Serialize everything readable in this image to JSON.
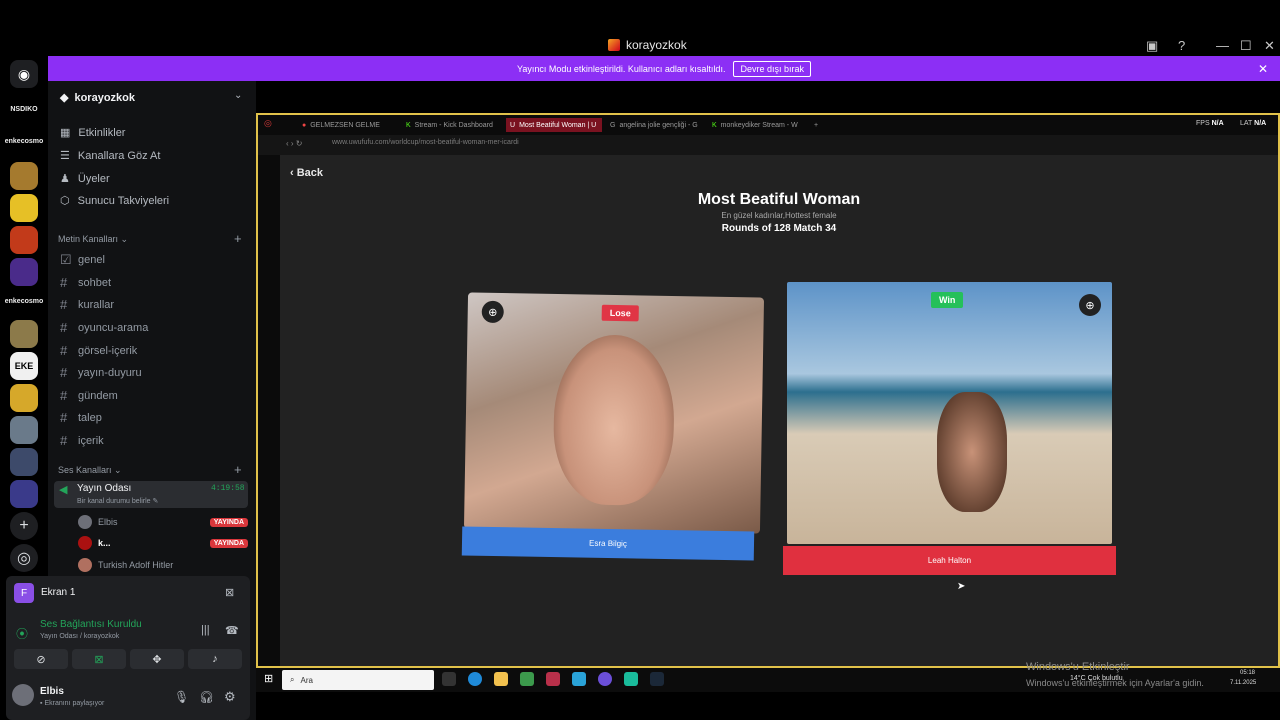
{
  "window": {
    "title": "korayozkok"
  },
  "banner": {
    "text": "Yayıncı Modu etkinleştirildi. Kullanıcı adları kısaltıldı.",
    "button": "Devre dışı bırak"
  },
  "rail": {
    "labels": [
      "NSDIKO",
      "enkecosmo",
      "enkecosmo",
      "EKE"
    ]
  },
  "sidebar": {
    "server_name": "korayozkok",
    "menu": [
      "Etkinlikler",
      "Kanallara Göz At",
      "Üyeler",
      "Sunucu Takviyeleri"
    ],
    "text_category": "Metin Kanalları",
    "text_channels": [
      "genel",
      "sohbet",
      "kurallar",
      "oyuncu-arama",
      "görsel-içerik",
      "yayın-duyuru",
      "gündem",
      "talep",
      "içerik"
    ],
    "voice_category": "Ses Kanalları",
    "voice_channel": {
      "name": "Yayın Odası",
      "timer": "4:19:58",
      "status": "Bir kanal durumu belirle"
    },
    "voice_users": [
      {
        "name": "Elbis",
        "badge": "YAYINDA"
      },
      {
        "name": "k...",
        "badge": "YAYINDA"
      },
      {
        "name": "Turkish Adolf Hitler",
        "badge": ""
      }
    ]
  },
  "panel": {
    "screen_title": "Ekran 1",
    "connection": "Ses Bağlantısı Kuruldu",
    "connection_sub": "Yayın Odası / korayozkok",
    "user": "Elbis",
    "user_status": "Ekranını paylaşıyor"
  },
  "browser": {
    "tabs": [
      "GELMEZSEN GELME",
      "Stream - Kick Dashboard",
      "Most Beatiful Woman | U",
      "angelina jolie gençliği - G",
      "monkeydiker Stream - W"
    ],
    "url": "www.uwufufu.com/worldcup/most-beatiful-woman-mer-icardi",
    "fps_label": "FPS",
    "fps_value": "N/A",
    "lat_label": "LAT",
    "lat_value": "N/A"
  },
  "page": {
    "back": "Back",
    "title": "Most Beatiful Woman",
    "subtitle": "En güzel kadınlar,Hottest female",
    "rounds": "Rounds of 128 Match 34",
    "left": {
      "badge": "Lose",
      "name": "Esra Bilgiç",
      "bar_color": "#3b7ddd"
    },
    "right": {
      "badge": "Win",
      "name": "Leah Halton",
      "bar_color": "#e0303f"
    }
  },
  "taskbar": {
    "search": "Ara",
    "weather": "14°C  Çok bulutlu",
    "time": "05:18",
    "date": "7.11.2025"
  },
  "watermark": {
    "line1": "Windows'u Etkinleştir",
    "line2": "Windows'u etkinleştirmek için Ayarlar'a gidin."
  }
}
